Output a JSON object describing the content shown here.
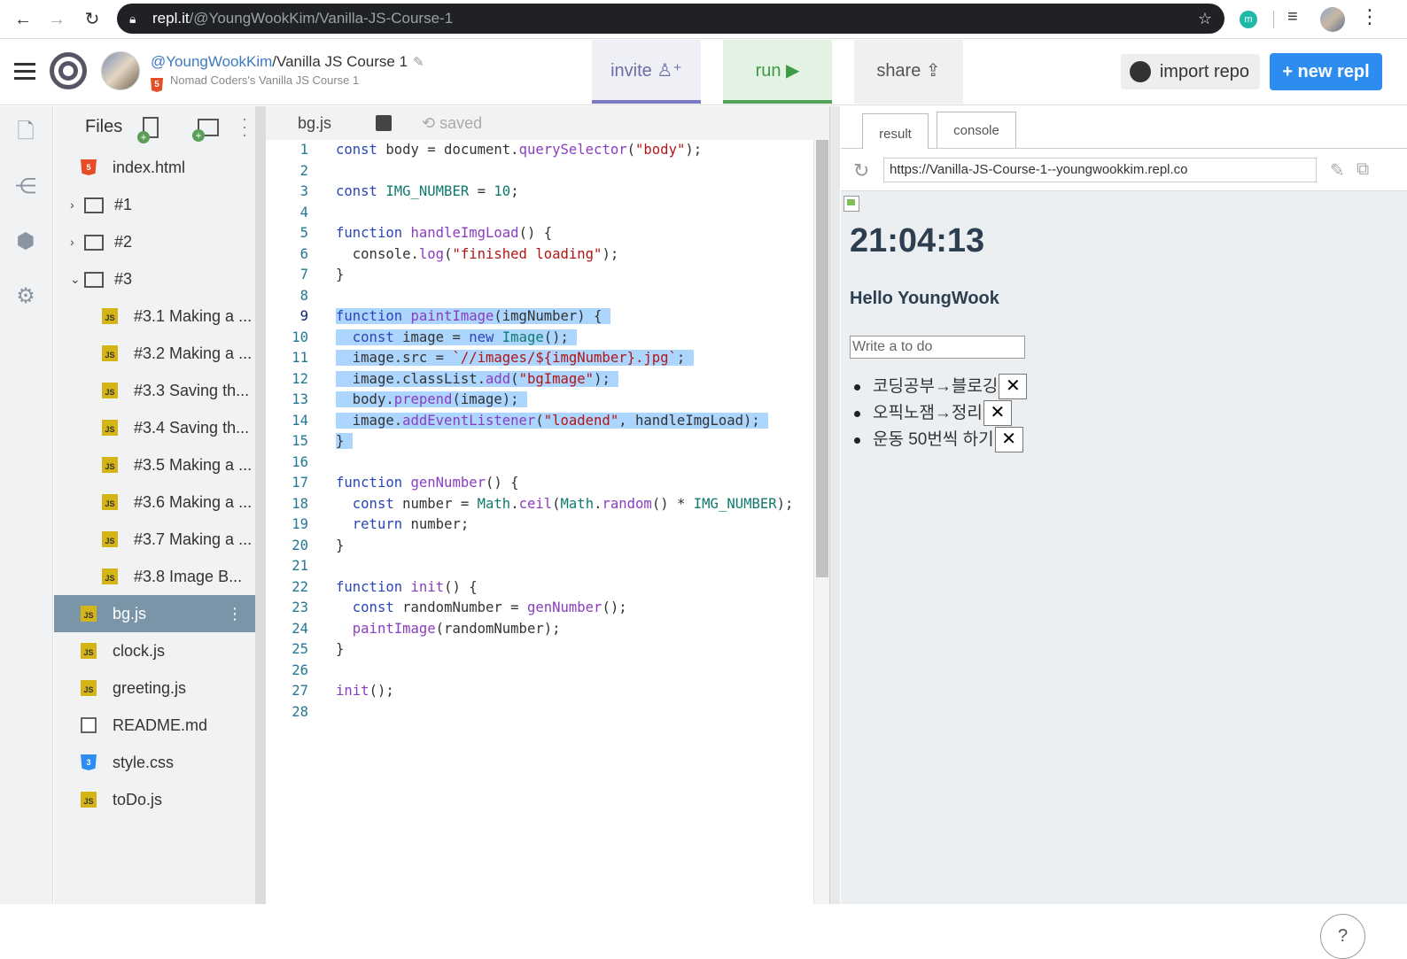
{
  "browser": {
    "url_host": "repl.it",
    "url_path": "/@YoungWookKim/Vanilla-JS-Course-1",
    "ext_initial": "m"
  },
  "header": {
    "user": "@YoungWookKim",
    "sep": "/",
    "repl_name": "Vanilla JS Course 1",
    "subtitle": "Nomad Coders's Vanilla JS Course 1",
    "invite": "invite",
    "run": "run",
    "share": "share",
    "import_repo": "import repo",
    "new_repl": "+ new repl"
  },
  "files": {
    "title": "Files",
    "items": [
      {
        "name": "index.html",
        "icon": "html-icon",
        "level": 0
      },
      {
        "name": "#1",
        "icon": "folder-icon",
        "level": 0,
        "chevron": "›"
      },
      {
        "name": "#2",
        "icon": "folder-icon",
        "level": 0,
        "chevron": "›"
      },
      {
        "name": "#3",
        "icon": "folder-icon",
        "level": 0,
        "chevron": "⌄"
      },
      {
        "name": "#3.1 Making a ...",
        "icon": "js-icon",
        "level": 1
      },
      {
        "name": "#3.2 Making a ...",
        "icon": "js-icon",
        "level": 1
      },
      {
        "name": "#3.3 Saving th...",
        "icon": "js-icon",
        "level": 1
      },
      {
        "name": "#3.4 Saving th...",
        "icon": "js-icon",
        "level": 1
      },
      {
        "name": "#3.5 Making a ...",
        "icon": "js-icon",
        "level": 1
      },
      {
        "name": "#3.6 Making a ...",
        "icon": "js-icon",
        "level": 1
      },
      {
        "name": "#3.7 Making a ...",
        "icon": "js-icon",
        "level": 1
      },
      {
        "name": "#3.8 Image B...",
        "icon": "js-icon",
        "level": 1
      },
      {
        "name": "bg.js",
        "icon": "js-icon",
        "level": 0,
        "selected": true
      },
      {
        "name": "clock.js",
        "icon": "js-icon",
        "level": 0
      },
      {
        "name": "greeting.js",
        "icon": "js-icon",
        "level": 0
      },
      {
        "name": "README.md",
        "icon": "file-icon",
        "level": 0
      },
      {
        "name": "style.css",
        "icon": "css-icon",
        "level": 0
      },
      {
        "name": "toDo.js",
        "icon": "js-icon",
        "level": 0
      }
    ]
  },
  "editor": {
    "tab": "bg.js",
    "saved": "saved",
    "current_line": 9,
    "lines": [
      "const body = document.querySelector(\"body\");",
      "",
      "const IMG_NUMBER = 10;",
      "",
      "function handleImgLoad() {",
      "  console.log(\"finished loading\");",
      "}",
      "",
      "function paintImage(imgNumber) {",
      "  const image = new Image();",
      "  image.src = `//images/${imgNumber}.jpg`;",
      "  image.classList.add(\"bgImage\");",
      "  body.prepend(image);",
      "  image.addEventListener(\"loadend\", handleImgLoad);",
      "}",
      "",
      "function genNumber() {",
      "  const number = Math.ceil(Math.random() * IMG_NUMBER);",
      "  return number;",
      "}",
      "",
      "function init() {",
      "  const randomNumber = genNumber();",
      "  paintImage(randomNumber);",
      "}",
      "",
      "init();",
      ""
    ],
    "selected_lines": [
      9,
      10,
      11,
      12,
      13,
      14,
      15
    ]
  },
  "preview": {
    "tabs": [
      "result",
      "console"
    ],
    "url": "https://Vanilla-JS-Course-1--youngwookkim.repl.co",
    "clock": "21:04:13",
    "greeting": "Hello YoungWook",
    "input_placeholder": "Write a to do",
    "todos": [
      "코딩공부→블로깅",
      "오픽노잼→정리",
      "운동 50번씩 하기"
    ],
    "delete_label": "✕",
    "help": "?"
  }
}
